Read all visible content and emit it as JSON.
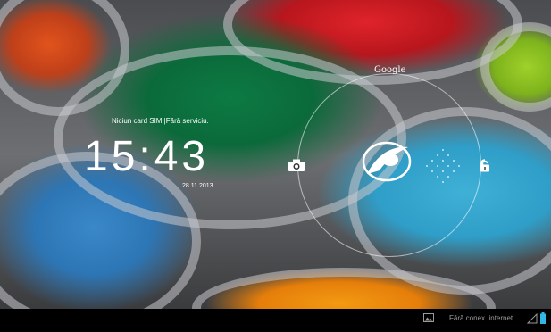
{
  "lockscreen": {
    "carrier_status": "Niciun card SIM.|Fără serviciu.",
    "time": "15:43",
    "date": "28.11.2013",
    "search_label": "Google"
  },
  "icons": {
    "camera": "camera-icon",
    "unlock": "unlock-icon",
    "handle": "unlock-handle-icon",
    "gallery": "image-icon",
    "signal": "signal-icon",
    "battery": "battery-icon"
  },
  "statusbar": {
    "connection_text": "Fără conex. internet"
  },
  "colors": {
    "battery": "#33b5e5",
    "status_text": "#9a9a9a"
  }
}
